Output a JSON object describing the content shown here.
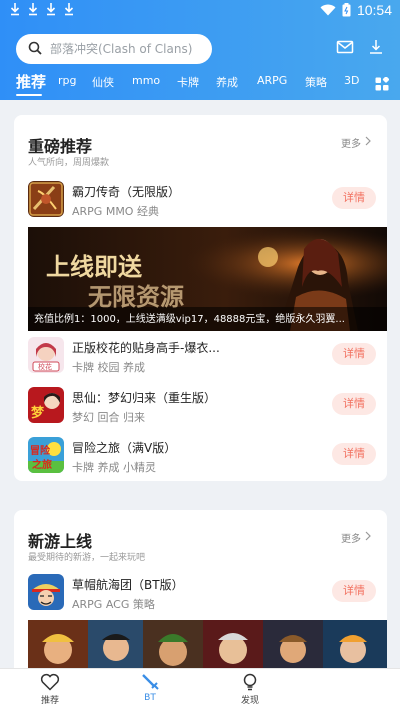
{
  "status_bar": {
    "time": "10:54",
    "icons": [
      "download-icon",
      "download-icon",
      "download-icon",
      "download-icon",
      "wifi-icon",
      "battery-icon"
    ]
  },
  "search": {
    "placeholder": "部落冲突(Clash of Clans)"
  },
  "tabs": [
    {
      "label": "推荐",
      "active": true
    },
    {
      "label": "rpg"
    },
    {
      "label": "仙侠"
    },
    {
      "label": "mmo"
    },
    {
      "label": "卡牌"
    },
    {
      "label": "养成"
    },
    {
      "label": "ARPG"
    },
    {
      "label": "策略"
    },
    {
      "label": "3D"
    }
  ],
  "featured": {
    "title": "重磅推荐",
    "subtitle": "人气所向，周周爆款",
    "more": "更多",
    "games": [
      {
        "name": "霸刀传奇（无限版）",
        "tags": "ARPG MMO 经典",
        "button": "详情"
      },
      {
        "name": "正版校花的贴身高手-爆衣...",
        "tags": "卡牌 校园 养成",
        "button": "详情"
      },
      {
        "name": "思仙：梦幻归来（重生版）",
        "tags": "梦幻 回合 归来",
        "button": "详情"
      },
      {
        "name": "冒险之旅（满V版）",
        "tags": "卡牌 养成 小精灵",
        "button": "详情"
      }
    ],
    "banner": {
      "headline_1": "上线即送",
      "headline_2": "无限资源",
      "caption": "充值比例1：1000，上线送满级vip17，48888元宝，绝版永久羽翼..."
    }
  },
  "new_games": {
    "title": "新游上线",
    "subtitle": "最受期待的新游，一起来玩吧",
    "more": "更多",
    "games": [
      {
        "name": "草帽航海团（BT版）",
        "tags": "ARPG ACG 策略",
        "button": "详情"
      }
    ]
  },
  "bottom_nav": [
    {
      "label": "推荐",
      "icon": "heart-icon"
    },
    {
      "label": "BT",
      "icon": "sword-icon",
      "active": true
    },
    {
      "label": "发现",
      "icon": "lightbulb-icon"
    }
  ],
  "colors": {
    "header_start": "#2f8ff7",
    "header_end": "#49a8ee",
    "detail_bg": "#fde8e4",
    "detail_text": "#f2705f",
    "active_nav": "#3a8ee6"
  }
}
